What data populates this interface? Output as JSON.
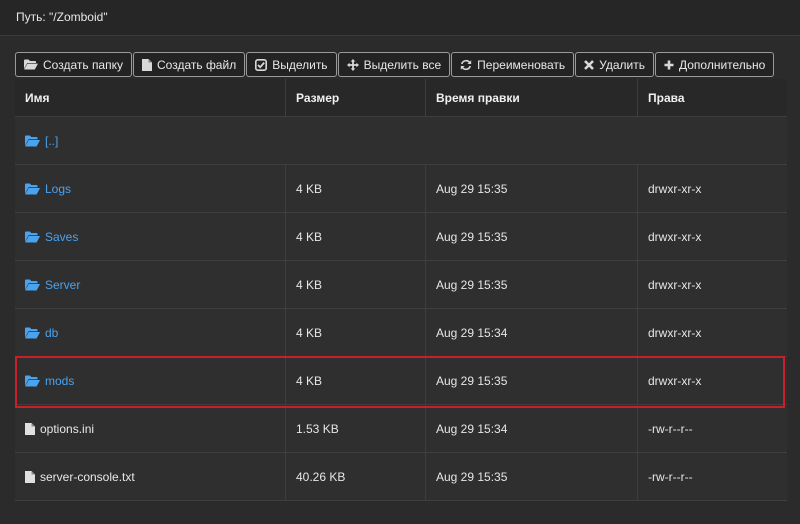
{
  "path": {
    "label": "Путь: \"/Zomboid\""
  },
  "toolbar": {
    "create_folder": "Создать папку",
    "create_file": "Создать файл",
    "select": "Выделить",
    "select_all": "Выделить все",
    "rename": "Переименовать",
    "delete": "Удалить",
    "more": "Дополнительно"
  },
  "table": {
    "headers": {
      "name": "Имя",
      "size": "Размер",
      "modified": "Время правки",
      "perms": "Права"
    },
    "parent": "[..]",
    "rows": [
      {
        "name": "Logs",
        "type": "folder",
        "size": "4 KB",
        "modified": "Aug 29 15:35",
        "perms": "drwxr-xr-x"
      },
      {
        "name": "Saves",
        "type": "folder",
        "size": "4 KB",
        "modified": "Aug 29 15:35",
        "perms": "drwxr-xr-x"
      },
      {
        "name": "Server",
        "type": "folder",
        "size": "4 KB",
        "modified": "Aug 29 15:35",
        "perms": "drwxr-xr-x"
      },
      {
        "name": "db",
        "type": "folder",
        "size": "4 KB",
        "modified": "Aug 29 15:34",
        "perms": "drwxr-xr-x"
      },
      {
        "name": "mods",
        "type": "folder",
        "size": "4 KB",
        "modified": "Aug 29 15:35",
        "perms": "drwxr-xr-x"
      },
      {
        "name": "options.ini",
        "type": "file",
        "size": "1.53 KB",
        "modified": "Aug 29 15:34",
        "perms": "-rw-r--r--"
      },
      {
        "name": "server-console.txt",
        "type": "file",
        "size": "40.26 KB",
        "modified": "Aug 29 15:35",
        "perms": "-rw-r--r--"
      }
    ]
  },
  "icons": {
    "folder": "folder-open-icon",
    "file": "file-icon"
  },
  "colors": {
    "link": "#4aa3ef",
    "highlight": "#c8202a",
    "background": "#2b2b2b"
  }
}
